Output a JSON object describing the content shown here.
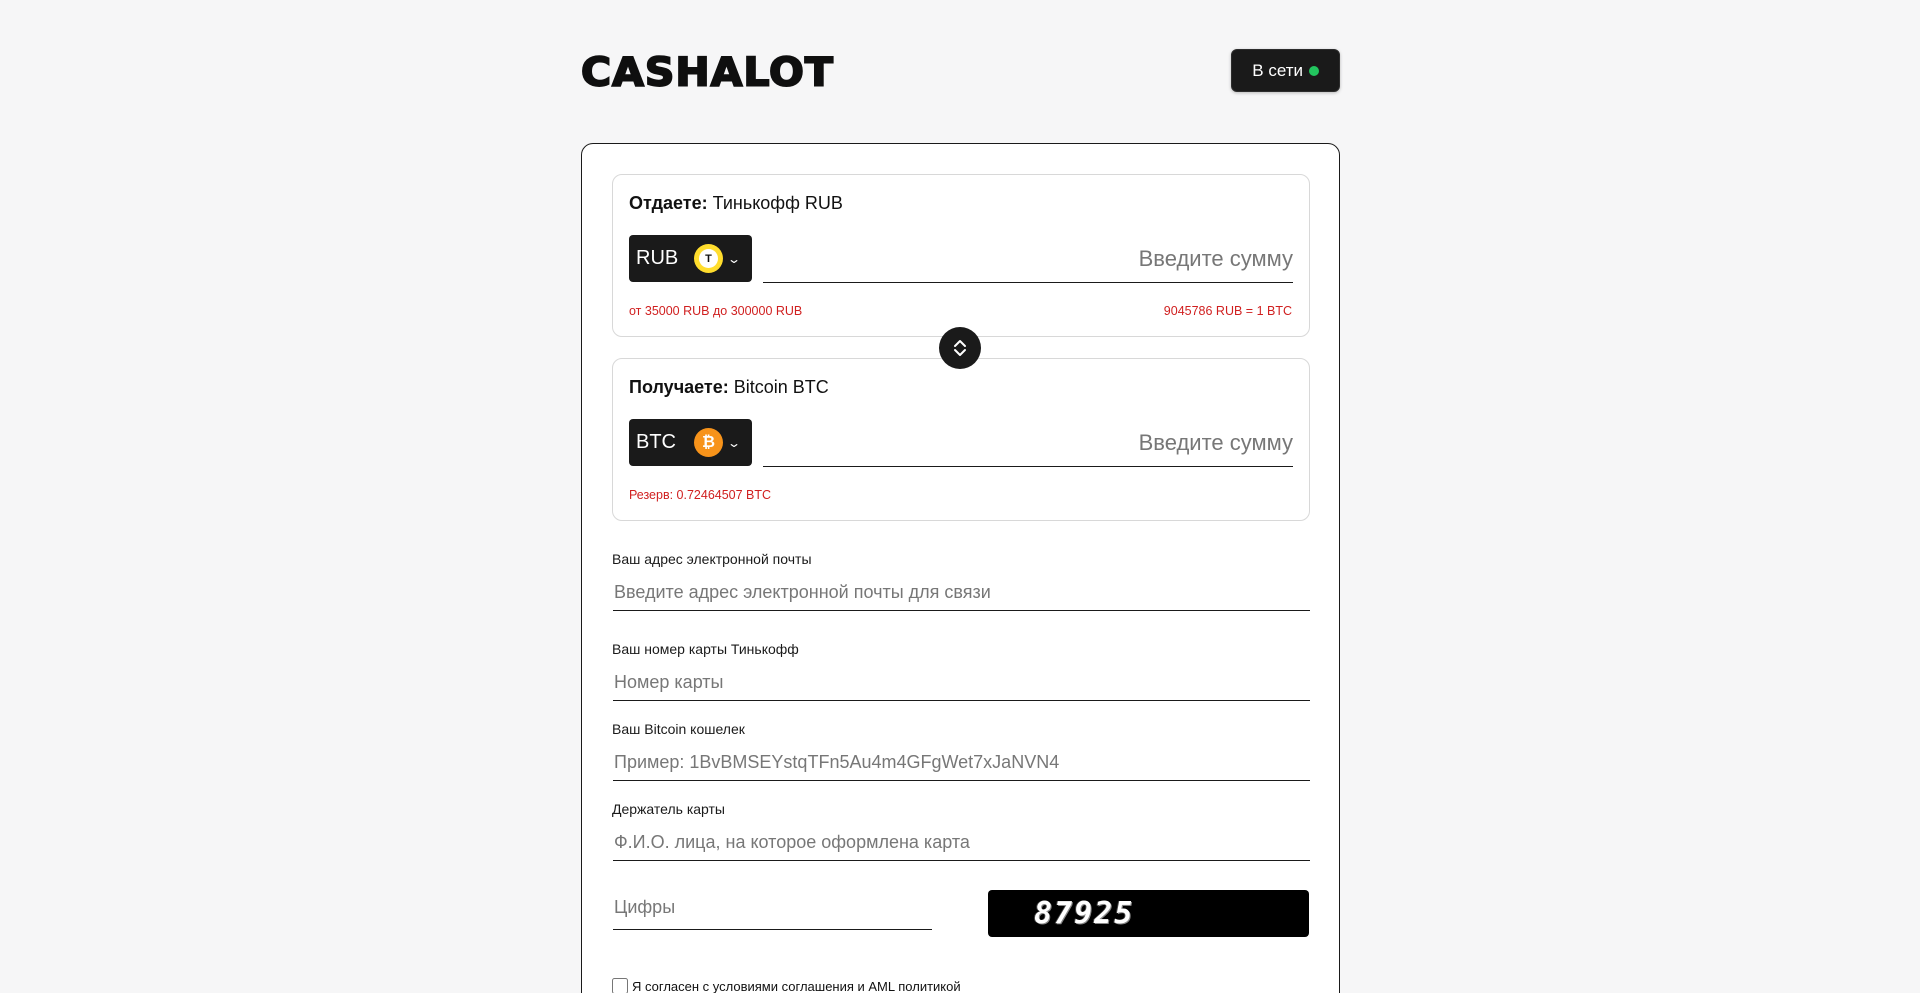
{
  "header": {
    "logo": "CASHALOT",
    "status_label": "В сети",
    "status_color": "#22c55e"
  },
  "give": {
    "title_bold": "Отдаете:",
    "title_value": "Тинькофф RUB",
    "currency": "RUB",
    "coin_icon": "tinkoff-icon",
    "amount_placeholder": "Введите сумму",
    "limits": "от 35000 RUB до 300000 RUB",
    "rate": "9045786 RUB = 1 BTC"
  },
  "get": {
    "title_bold": "Получаете:",
    "title_value": "Bitcoin BTC",
    "currency": "BTC",
    "coin_icon": "bitcoin-icon",
    "amount_placeholder": "Введите сумму",
    "reserve": "Резерв: 0.72464507 BTC"
  },
  "form": {
    "email_label": "Ваш адрес электронной почты",
    "email_placeholder": "Введите адрес электронной почты для связи",
    "card_label": "Ваш номер карты Тинькофф",
    "card_placeholder": "Номер карты",
    "wallet_label": "Ваш Bitcoin кошелек",
    "wallet_placeholder": "Пример: 1BvBMSEYstqTFn5Au4m4GFgWet7xJaNVN4",
    "holder_label": "Держатель карты",
    "holder_placeholder": "Ф.И.О. лица, на которое оформлена карта",
    "captcha_placeholder": "Цифры",
    "captcha_code": "87925",
    "agree_label": "Я согласен с условиями соглашения и AML политикой"
  },
  "colors": {
    "accent_dark": "#1a1a1a",
    "hint_red": "#d01f1f",
    "bitcoin_orange": "#f7931a",
    "tinkoff_yellow": "#ffdd2d"
  }
}
